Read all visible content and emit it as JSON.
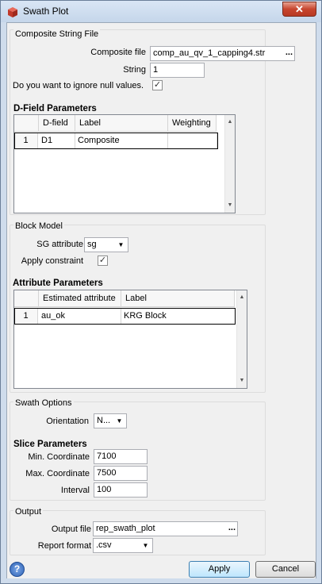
{
  "window": {
    "title": "Swath Plot",
    "close_glyph": "✕"
  },
  "composite": {
    "group_title": "Composite String File",
    "file_label": "Composite file",
    "file_value": "comp_au_qv_1_capping4.str",
    "browse_label": "...",
    "string_label": "String",
    "string_value": "1",
    "ignore_null_label": "Do you want to ignore null values.",
    "ignore_null_checked": true
  },
  "dfield": {
    "title": "D-Field Parameters",
    "columns": [
      "D-field",
      "Label",
      "Weighting"
    ],
    "rows": [
      {
        "num": "1",
        "dfield": "D1",
        "label": "Composite",
        "weighting": ""
      }
    ]
  },
  "block_model": {
    "group_title": "Block Model",
    "sg_label": "SG attribute",
    "sg_value": "sg",
    "constraint_label": "Apply constraint",
    "constraint_checked": true
  },
  "attributes": {
    "title": "Attribute Parameters",
    "columns": [
      "Estimated attribute",
      "Label"
    ],
    "rows": [
      {
        "num": "1",
        "attribute": "au_ok",
        "label": "KRG Block"
      }
    ]
  },
  "swath": {
    "group_title": "Swath Options",
    "orientation_label": "Orientation",
    "orientation_value": "N...",
    "slice_title": "Slice Parameters",
    "min_label": "Min. Coordinate",
    "min_value": "7100",
    "max_label": "Max. Coordinate",
    "max_value": "7500",
    "interval_label": "Interval",
    "interval_value": "100"
  },
  "output": {
    "group_title": "Output",
    "file_label": "Output file",
    "file_value": "rep_swath_plot",
    "browse_label": "...",
    "format_label": "Report format",
    "format_value": ".csv"
  },
  "footer": {
    "help_glyph": "?",
    "apply_label": "Apply",
    "cancel_label": "Cancel"
  },
  "icons": {
    "check": "✓",
    "dropdown": "▼",
    "scroll_up": "▲",
    "scroll_down": "▼"
  }
}
